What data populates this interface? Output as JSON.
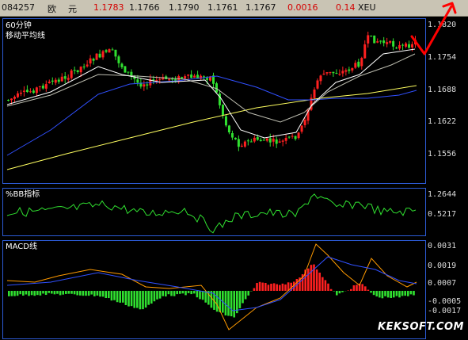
{
  "quote_bar": {
    "code": "084257",
    "name1": "欧",
    "name2": "元",
    "last": "1.1783",
    "open": "1.1766",
    "high": "1.1790",
    "low": "1.1761",
    "prev": "1.1767",
    "change": "0.0016",
    "pct": "0.14",
    "market": "XEU"
  },
  "price_panel": {
    "title": "60分钟",
    "subtitle": "移动平均线",
    "ticks": [
      "1.1820",
      "1.1754",
      "1.1688",
      "1.1622",
      "1.1556"
    ]
  },
  "bb_panel": {
    "title": "%BB指标",
    "ticks": [
      "1.2644",
      "0.5217"
    ]
  },
  "macd_panel": {
    "title": "MACD线",
    "ticks": [
      "0.0031",
      "0.0019",
      "0.0007",
      "-0.0005",
      "-0.0017"
    ]
  },
  "watermark": "KEKSOFT.COM",
  "colors": {
    "up": "#ff2020",
    "down": "#30e030",
    "ma_white": "#ffffff",
    "ma_gray": "#bdbdb0",
    "ma_blue": "#3050ff",
    "ma_yellow": "#ffff60",
    "frame": "#2c5bd6",
    "dif": "#ff9a00",
    "dea": "#3050ff",
    "trend_arrow": "#ff0000"
  }
}
